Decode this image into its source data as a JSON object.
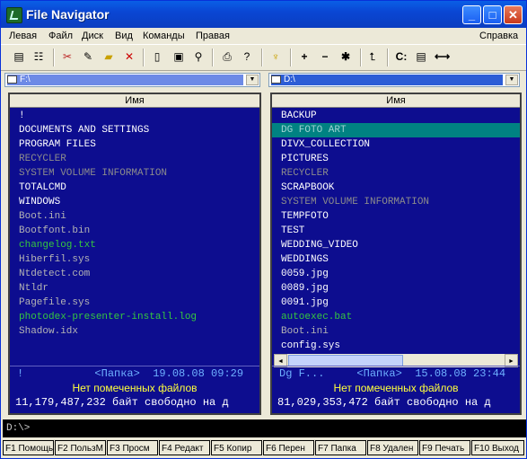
{
  "window": {
    "title": "File Navigator",
    "buttons": {
      "minimize": "_",
      "maximize": "□",
      "close": "✕"
    }
  },
  "menu": [
    "Левая",
    "Файл",
    "Диск",
    "Вид",
    "Команды",
    "Правая",
    "Справка"
  ],
  "toolbar": {
    "drive_label": "C:"
  },
  "left": {
    "path": "F:\\",
    "header": "Имя",
    "items": [
      {
        "name": "!",
        "kind": "dir"
      },
      {
        "name": "DOCUMENTS AND SETTINGS",
        "kind": "dir"
      },
      {
        "name": "PROGRAM FILES",
        "kind": "dir"
      },
      {
        "name": "RECYCLER",
        "kind": "hid"
      },
      {
        "name": "SYSTEM VOLUME INFORMATION",
        "kind": "hid"
      },
      {
        "name": "TOTALCMD",
        "kind": "dir"
      },
      {
        "name": "WINDOWS",
        "kind": "dir"
      },
      {
        "name": "Boot.ini",
        "kind": "sys"
      },
      {
        "name": "Bootfont.bin",
        "kind": "sys"
      },
      {
        "name": "changelog.txt",
        "kind": "exe"
      },
      {
        "name": "Hiberfil.sys",
        "kind": "sys"
      },
      {
        "name": "Ntdetect.com",
        "kind": "sys"
      },
      {
        "name": "Ntldr",
        "kind": "sys"
      },
      {
        "name": "Pagefile.sys",
        "kind": "sys"
      },
      {
        "name": "photodex-presenter-install.log",
        "kind": "exe"
      },
      {
        "name": "Shadow.idx",
        "kind": "sys"
      }
    ],
    "status": {
      "line1": "!           <Папка>  19.08.08 09:29",
      "line2": "Нет помеченных файлов",
      "line3": "11,179,487,232 байт свободно на д"
    }
  },
  "right": {
    "path": "D:\\",
    "header": "Имя",
    "items": [
      {
        "name": "BACKUP",
        "kind": "dir"
      },
      {
        "name": "DG FOTO ART",
        "kind": "sel"
      },
      {
        "name": "DIVX_COLLECTION",
        "kind": "dir"
      },
      {
        "name": "PICTURES",
        "kind": "dir"
      },
      {
        "name": "RECYCLER",
        "kind": "hid"
      },
      {
        "name": "SCRAPBOOK",
        "kind": "dir"
      },
      {
        "name": "SYSTEM VOLUME INFORMATION",
        "kind": "hid"
      },
      {
        "name": "TEMPFOTO",
        "kind": "dir"
      },
      {
        "name": "TEST",
        "kind": "dir"
      },
      {
        "name": "WEDDING_VIDEO",
        "kind": "dir"
      },
      {
        "name": "WEDDINGS",
        "kind": "dir"
      },
      {
        "name": "0059.jpg",
        "kind": "dir"
      },
      {
        "name": "0089.jpg",
        "kind": "dir"
      },
      {
        "name": "0091.jpg",
        "kind": "dir"
      },
      {
        "name": "autoexec.bat",
        "kind": "exe"
      },
      {
        "name": "Boot.ini",
        "kind": "sys"
      },
      {
        "name": "config.sys",
        "kind": "dir"
      }
    ],
    "scroll_left": "◄",
    "scroll_right": "►",
    "status": {
      "line1": "Dg F...     <Папка>  15.08.08 23:44",
      "line2": "Нет помеченных файлов",
      "line3": "81,029,353,472 байт свободно на д"
    }
  },
  "cmdline": "D:\\>",
  "fkeys": [
    "F1 Помощь",
    "F2 ПользМ",
    "F3 Просм",
    "F4 Редакт",
    "F5 Копир",
    "F6 Перен",
    "F7 Папка",
    "F8 Удален",
    "F9 Печать",
    "F10 Выход"
  ]
}
